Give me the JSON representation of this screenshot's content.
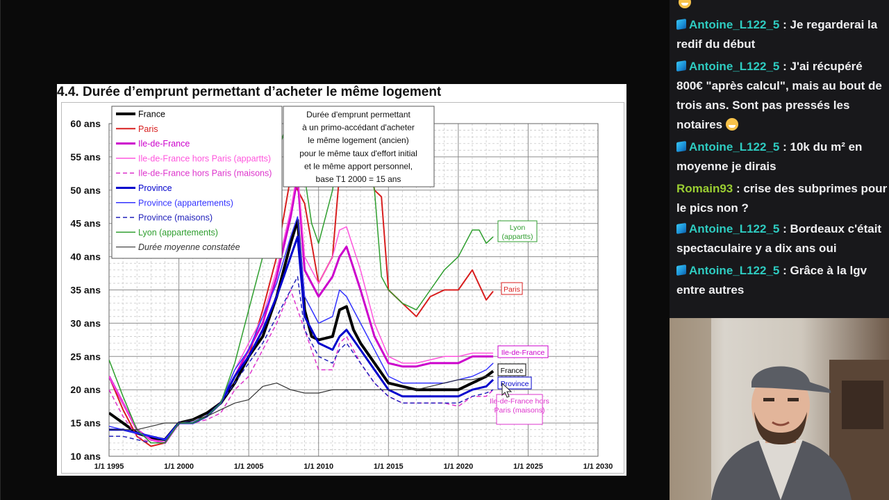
{
  "chart_data": {
    "type": "line",
    "title": "4.4. Durée d’emprunt permettant d’acheter le même logement",
    "note_lines": [
      "Durée d'emprunt permettant",
      "à un primo-accédant d'acheter",
      "le même logement (ancien)",
      "pour le même taux d'effort initial",
      "et le même apport personnel,",
      "base T1 2000 = 15 ans"
    ],
    "xlim": [
      1995,
      2030
    ],
    "ylim": [
      10,
      60
    ],
    "x_ticks": [
      {
        "v": 1995,
        "label": "1/1 1995"
      },
      {
        "v": 2000,
        "label": "1/1 2000"
      },
      {
        "v": 2005,
        "label": "1/1 2005"
      },
      {
        "v": 2010,
        "label": "1/1 2010"
      },
      {
        "v": 2015,
        "label": "1/1 2015"
      },
      {
        "v": 2020,
        "label": "1/1 2020"
      },
      {
        "v": 2025,
        "label": "1/1 2025"
      },
      {
        "v": 2030,
        "label": "1/1 2030"
      }
    ],
    "y_ticks": [
      {
        "v": 10,
        "label": "10 ans"
      },
      {
        "v": 15,
        "label": "15 ans"
      },
      {
        "v": 20,
        "label": "20 ans"
      },
      {
        "v": 25,
        "label": "25 ans"
      },
      {
        "v": 30,
        "label": "30 ans"
      },
      {
        "v": 35,
        "label": "35 ans"
      },
      {
        "v": 40,
        "label": "40 ans"
      },
      {
        "v": 45,
        "label": "45 ans"
      },
      {
        "v": 50,
        "label": "50 ans"
      },
      {
        "v": 55,
        "label": "55 ans"
      },
      {
        "v": 60,
        "label": "60 ans"
      }
    ],
    "grid": true,
    "legend_position": "top-left",
    "series": [
      {
        "name": "France",
        "color": "#000000",
        "width": 4,
        "dash": "",
        "italic": false,
        "x": [
          1995,
          1996,
          1997,
          1998,
          1999,
          2000,
          2001,
          2002,
          2003,
          2004,
          2005,
          2006,
          2007,
          2008,
          2008.5,
          2009,
          2009.5,
          2010,
          2011,
          2011.5,
          2012,
          2012.5,
          2013,
          2014,
          2015,
          2016,
          2017,
          2018,
          2019,
          2020,
          2021,
          2022,
          2022.5
        ],
        "y": [
          16.5,
          15,
          13.5,
          12.8,
          12.5,
          15,
          15.5,
          16.5,
          18,
          21,
          25,
          28,
          34,
          42,
          45.5,
          32,
          28,
          27.5,
          28,
          32,
          32.5,
          29,
          27,
          24,
          21,
          20.5,
          20,
          20,
          20,
          20,
          21,
          22,
          22.8
        ]
      },
      {
        "name": "Paris",
        "color": "#d81e1e",
        "width": 2,
        "dash": "",
        "italic": false,
        "x": [
          1995,
          1996,
          1997,
          1998,
          1999,
          2000,
          2001,
          2002,
          2003,
          2004,
          2005,
          2006,
          2007,
          2008,
          2009,
          2010,
          2011,
          2012,
          2013,
          2014,
          2014.5,
          2015,
          2016,
          2017,
          2018,
          2019,
          2020,
          2021,
          2022,
          2022.5
        ],
        "y": [
          22,
          17,
          13,
          11.5,
          12,
          15,
          15,
          16,
          18,
          22,
          25,
          32,
          40,
          52,
          48,
          36,
          40,
          65,
          62,
          50,
          49,
          35,
          33,
          31,
          34,
          35,
          35,
          38,
          33.5,
          34.8
        ]
      },
      {
        "name": "Ile-de-France",
        "color": "#cc00cc",
        "width": 3,
        "dash": "",
        "italic": false,
        "x": [
          1995,
          1996,
          1997,
          1998,
          1999,
          2000,
          2001,
          2002,
          2003,
          2004,
          2005,
          2006,
          2007,
          2008,
          2008.5,
          2009,
          2010,
          2011,
          2011.5,
          2012,
          2013,
          2014,
          2015,
          2016,
          2017,
          2018,
          2019,
          2020,
          2021,
          2022,
          2022.5
        ],
        "y": [
          22,
          18,
          14,
          12.5,
          12,
          15,
          15,
          16,
          18,
          22,
          26,
          30,
          37,
          46,
          52,
          38,
          34,
          37,
          40,
          41.5,
          35,
          28,
          24,
          23.5,
          23.5,
          24,
          24,
          24,
          25,
          25,
          25
        ]
      },
      {
        "name": "Ile-de-France hors Paris (appartts)",
        "color": "#ff55dd",
        "width": 1.5,
        "dash": "",
        "italic": false,
        "x": [
          1995,
          1996,
          1997,
          1998,
          1999,
          2000,
          2001,
          2002,
          2003,
          2004,
          2005,
          2006,
          2007,
          2008,
          2008.5,
          2009,
          2010,
          2011,
          2011.5,
          2012,
          2013,
          2014,
          2015,
          2016,
          2017,
          2018,
          2019,
          2020,
          2021,
          2022,
          2022.5
        ],
        "y": [
          22,
          18,
          14,
          12.5,
          12,
          15,
          15,
          16,
          18,
          23,
          27,
          31,
          38,
          47,
          53,
          40,
          36,
          40,
          44,
          44.5,
          38,
          30,
          25,
          24,
          24,
          24.5,
          25,
          25,
          25.5,
          25.5,
          25.5
        ]
      },
      {
        "name": "Ile-de-France hors Paris (maisons)",
        "color": "#dd33cc",
        "width": 1.5,
        "dash": "6,4",
        "italic": false,
        "x": [
          1995,
          1996,
          1997,
          1998,
          1999,
          2000,
          2001,
          2002,
          2003,
          2004,
          2005,
          2006,
          2007,
          2008,
          2009,
          2010,
          2011,
          2011.5,
          2012,
          2013,
          2014,
          2015,
          2016,
          2017,
          2018,
          2019,
          2020,
          2021,
          2022,
          2022.5
        ],
        "y": [
          20,
          16,
          13,
          12,
          12,
          15,
          15,
          15.5,
          16.5,
          20,
          22,
          26,
          30,
          35,
          29,
          23,
          23,
          27,
          28,
          24,
          21,
          19,
          18,
          18,
          18,
          18,
          17.5,
          19,
          19,
          20
        ]
      },
      {
        "name": "Province",
        "color": "#0000cc",
        "width": 3,
        "dash": "",
        "italic": false,
        "x": [
          1995,
          1996,
          1997,
          1998,
          1999,
          2000,
          2001,
          2002,
          2003,
          2004,
          2005,
          2006,
          2007,
          2008,
          2008.5,
          2009,
          2010,
          2011,
          2011.5,
          2012,
          2013,
          2014,
          2015,
          2016,
          2017,
          2018,
          2019,
          2020,
          2021,
          2022,
          2022.5
        ],
        "y": [
          14,
          14,
          13.5,
          13,
          12.5,
          15,
          15,
          16,
          18,
          22,
          25,
          29,
          34,
          40,
          43,
          31,
          27,
          26,
          28,
          29,
          26,
          23,
          20,
          19,
          19,
          19,
          19,
          19,
          20,
          20.5,
          21.5
        ]
      },
      {
        "name": "Province (appartements)",
        "color": "#3333ff",
        "width": 1.5,
        "dash": "",
        "italic": false,
        "x": [
          1995,
          1996,
          1997,
          1998,
          1999,
          2000,
          2001,
          2002,
          2003,
          2004,
          2005,
          2006,
          2007,
          2008,
          2008.5,
          2009,
          2010,
          2011,
          2011.5,
          2012,
          2013,
          2014,
          2015,
          2016,
          2017,
          2018,
          2019,
          2020,
          2021,
          2022,
          2022.5
        ],
        "y": [
          14.5,
          14,
          13.5,
          13,
          12.5,
          15,
          15,
          16,
          18,
          23,
          26,
          31,
          36,
          43,
          46,
          34,
          30,
          31,
          35,
          34,
          30,
          26,
          22,
          21,
          21,
          21,
          21,
          21.5,
          22,
          23,
          24
        ]
      },
      {
        "name": "Province (maisons)",
        "color": "#2222bb",
        "width": 1.5,
        "dash": "6,4",
        "italic": false,
        "x": [
          1995,
          1996,
          1997,
          1998,
          1999,
          2000,
          2001,
          2002,
          2003,
          2004,
          2005,
          2006,
          2007,
          2008,
          2008.5,
          2009,
          2010,
          2011,
          2011.5,
          2012,
          2013,
          2014,
          2015,
          2016,
          2017,
          2018,
          2019,
          2020,
          2021,
          2022,
          2022.5
        ],
        "y": [
          13,
          13,
          12.5,
          12,
          12,
          15,
          15,
          16,
          18,
          21,
          24,
          27,
          31,
          35,
          37,
          29,
          25,
          24,
          26,
          27,
          24,
          21,
          19,
          18,
          18,
          18,
          18,
          18,
          19,
          19.5,
          20
        ]
      },
      {
        "name": "Lyon (appartements)",
        "color": "#2e9e2e",
        "width": 1.5,
        "dash": "",
        "italic": false,
        "x": [
          1995,
          1996,
          1997,
          1998,
          1999,
          2000,
          2001,
          2002,
          2003,
          2004,
          2005,
          2006,
          2007,
          2008,
          2008.5,
          2009,
          2009.5,
          2010,
          2011,
          2012,
          2013,
          2014,
          2014.5,
          2015,
          2016,
          2017,
          2018,
          2019,
          2020,
          2021,
          2021.5,
          2022,
          2022.5
        ],
        "y": [
          24.5,
          19,
          14,
          12,
          12,
          15,
          15,
          16,
          18,
          24,
          32,
          40,
          55,
          62,
          65,
          52,
          45,
          42,
          50,
          63,
          60,
          50,
          37,
          35,
          33,
          32,
          35,
          38,
          40,
          44,
          44,
          42,
          43
        ]
      },
      {
        "name": "Durée moyenne constatée",
        "color": "#333333",
        "width": 1.2,
        "dash": "",
        "italic": true,
        "x": [
          1995,
          1996,
          1997,
          1998,
          1999,
          2000,
          2001,
          2002,
          2003,
          2004,
          2005,
          2006,
          2007,
          2008,
          2009,
          2010,
          2011,
          2012,
          2013,
          2014,
          2015,
          2016,
          2017,
          2018,
          2019,
          2020,
          2021,
          2022,
          2022.5
        ],
        "y": [
          14,
          14,
          14,
          14.5,
          15,
          15,
          15.5,
          16,
          17,
          18,
          18.5,
          20.5,
          21,
          20,
          19.5,
          19.5,
          20,
          20,
          20,
          20,
          20,
          20,
          20,
          20.5,
          21,
          21.5,
          21.5,
          22,
          22
        ]
      }
    ],
    "end_labels": [
      {
        "text": "Lyon (appartts)",
        "color": "#2e9e2e",
        "border": "#2e9e2e"
      },
      {
        "text": "Paris",
        "color": "#d81e1e",
        "border": "#d81e1e"
      },
      {
        "text": "Ile-de-France",
        "color": "#cc00cc",
        "border": "#cc00cc"
      },
      {
        "text": "France",
        "color": "#000000",
        "border": "#000000"
      },
      {
        "text": "Province",
        "color": "#0000cc",
        "border": "#0000cc"
      },
      {
        "text": "Ile-de-France hors Paris (maisons)",
        "color": "#dd33cc",
        "border": "#dd33cc"
      }
    ]
  },
  "chat": {
    "messages": [
      {
        "user": "Antoine_L122_5",
        "has_badge": true,
        "text": "Je regarderai la redif du début"
      },
      {
        "user": "Antoine_L122_5",
        "has_badge": true,
        "text": "J'ai récupéré 800€ \"après calcul\", mais au bout de trois ans. Sont pas pressés les notaires",
        "emoji": "grinning-face-emoji"
      },
      {
        "user": "Antoine_L122_5",
        "has_badge": true,
        "text": "10k du m² en moyenne je dirais"
      },
      {
        "user": "Romain93",
        "has_badge": false,
        "text": "crise des subprimes pour le pics non ?"
      },
      {
        "user": "Antoine_L122_5",
        "has_badge": true,
        "text": "Bordeaux c'était spectaculaire y a dix ans oui"
      },
      {
        "user": "Antoine_L122_5",
        "has_badge": true,
        "text": "Grâce à la lgv entre autres"
      }
    ]
  },
  "webcam": {
    "label": "streamer-webcam"
  }
}
